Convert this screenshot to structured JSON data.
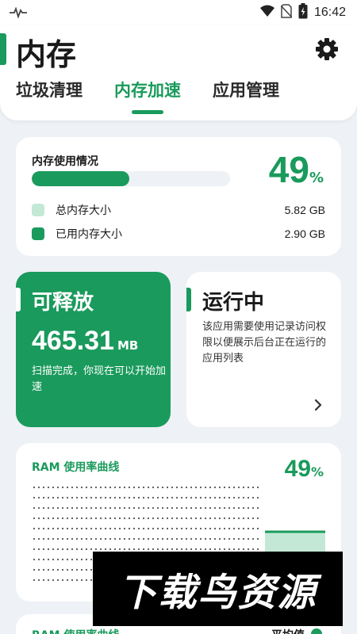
{
  "status_bar": {
    "time": "16:42",
    "icons": [
      "pulse-icon",
      "wifi-icon",
      "no-sim-icon",
      "battery-icon"
    ]
  },
  "header": {
    "title": "内存",
    "settings_icon": "gear-icon",
    "tabs": [
      {
        "label": "垃圾清理",
        "active": false
      },
      {
        "label": "内存加速",
        "active": true
      },
      {
        "label": "应用管理",
        "active": false
      }
    ]
  },
  "memory": {
    "title": "内存使用情况",
    "usage_percent": 49,
    "percent_symbol": "%",
    "legend": [
      {
        "label": "总内存大小",
        "value": "5.82 GB",
        "color": "#c4e8d6"
      },
      {
        "label": "已用内存大小",
        "value": "2.90 GB",
        "color": "#1a9a5c"
      }
    ]
  },
  "release": {
    "title": "可释放",
    "amount": "465.31",
    "unit": "MB",
    "description": "扫描完成，你现在可以开始加速"
  },
  "running": {
    "title": "运行中",
    "description": "该应用需要使用记录访问权限以便展示后台正在运行的应用列表"
  },
  "ram_chart": {
    "title": "RAM 使用率曲线",
    "percent": "49",
    "percent_symbol": "%"
  },
  "ram_chart_2": {
    "title": "RAM 使用率曲线",
    "avg_label": "平均值"
  },
  "watermark": {
    "text": "下载鸟资源"
  },
  "colors": {
    "accent": "#1a9a5c",
    "accent_light": "#c4e8d6",
    "background": "#eef1f5"
  }
}
